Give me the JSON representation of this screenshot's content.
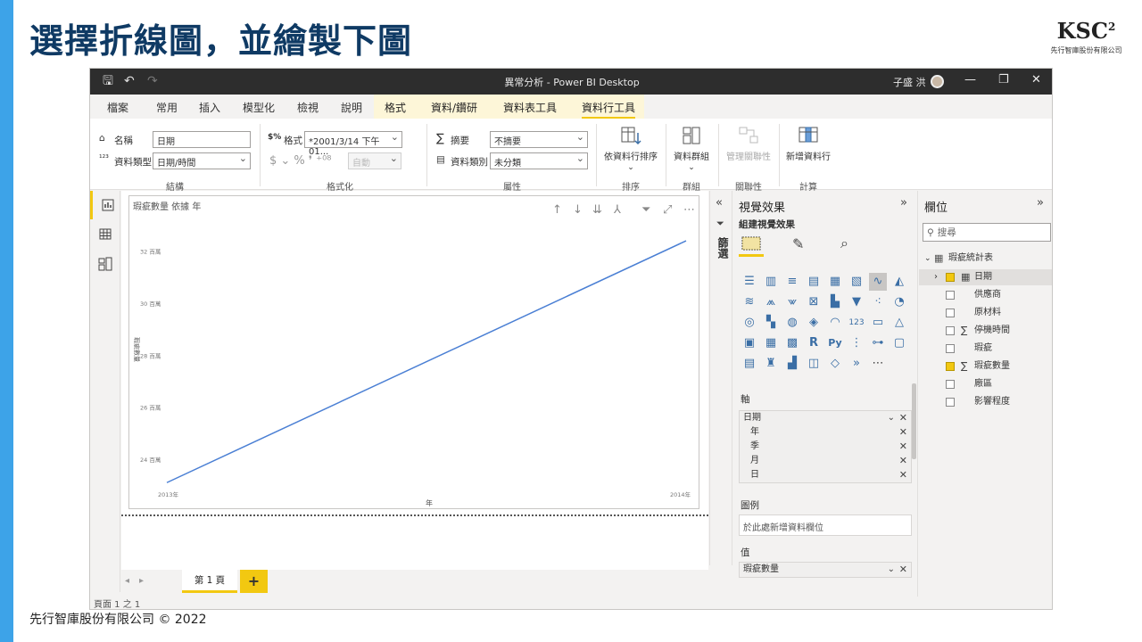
{
  "slide": {
    "title": "選擇折線圖，並繪製下圖",
    "logo_mark": "KSC",
    "logo_sup": "2",
    "logo_sub": "先行智庫股份有限公司",
    "footer": "先行智庫股份有限公司 © 2022"
  },
  "window": {
    "title": "異常分析 - Power BI Desktop",
    "user": "子盛 洪"
  },
  "tabs": [
    "檔案",
    "常用",
    "插入",
    "模型化",
    "檢視",
    "說明",
    "格式",
    "資料/鑽研",
    "資料表工具",
    "資料行工具"
  ],
  "ribbon": {
    "name_label": "名稱",
    "name_value": "日期",
    "datatype_label": "資料類型",
    "datatype_value": "日期/時間",
    "format_label": "格式",
    "format_value": "*2001/3/14 下午 01...",
    "auto_value": "自動",
    "summary_label": "摘要",
    "summary_value": "不摘要",
    "category_label": "資料類別",
    "category_value": "未分類",
    "sort_btn": "依資料行排序",
    "groups_btn": "資料群組",
    "relations_btn": "管理關聯性",
    "new_column_btn": "新增資料行",
    "group_structure": "結構",
    "group_formatting": "格式化",
    "group_properties": "屬性",
    "group_sort": "排序",
    "group_groups": "群組",
    "group_relations": "關聯性",
    "group_calc": "計算"
  },
  "visual": {
    "title": "瑕疵數量 依據 年",
    "y_axis_label": "瑕疵數量",
    "x_axis_label": "年"
  },
  "chart_data": {
    "type": "line",
    "x": [
      "2013年",
      "2014年"
    ],
    "series": [
      {
        "values": [
          23.1,
          32.4
        ]
      }
    ],
    "ylabel": "瑕疵數量",
    "xlabel": "年",
    "yticks": [
      "24 百萬",
      "26 百萬",
      "28 百萬",
      "30 百萬",
      "32 百萬"
    ],
    "ytick_values": [
      24,
      26,
      28,
      30,
      32
    ],
    "ylim": [
      22.8,
      33.5
    ],
    "grid": false,
    "line_color": "#4a7fd4"
  },
  "pages": {
    "tab": "第 1 頁",
    "add": "+",
    "status": "頁面 1 之 1"
  },
  "filters": {
    "label": "篩選"
  },
  "viz_pane": {
    "title": "視覺效果",
    "build_label": "組建視覺效果",
    "axis_label": "軸",
    "axis_items": [
      "日期",
      "年",
      "季",
      "月",
      "日"
    ],
    "legend_label": "圖例",
    "legend_placeholder": "於此處新增資料欄位",
    "values_label": "值",
    "values_item": "瑕疵數量"
  },
  "fields_pane": {
    "title": "欄位",
    "search_placeholder": "搜尋",
    "table_name": "瑕疵統計表",
    "fields": [
      {
        "name": "日期",
        "checked": true,
        "sigma": false
      },
      {
        "name": "供應商",
        "checked": false,
        "sigma": false
      },
      {
        "name": "原材料",
        "checked": false,
        "sigma": false
      },
      {
        "name": "停機時間",
        "checked": false,
        "sigma": true
      },
      {
        "name": "瑕疵",
        "checked": false,
        "sigma": false
      },
      {
        "name": "瑕疵數量",
        "checked": true,
        "sigma": true
      },
      {
        "name": "廠區",
        "checked": false,
        "sigma": false
      },
      {
        "name": "影響程度",
        "checked": false,
        "sigma": false
      }
    ]
  }
}
